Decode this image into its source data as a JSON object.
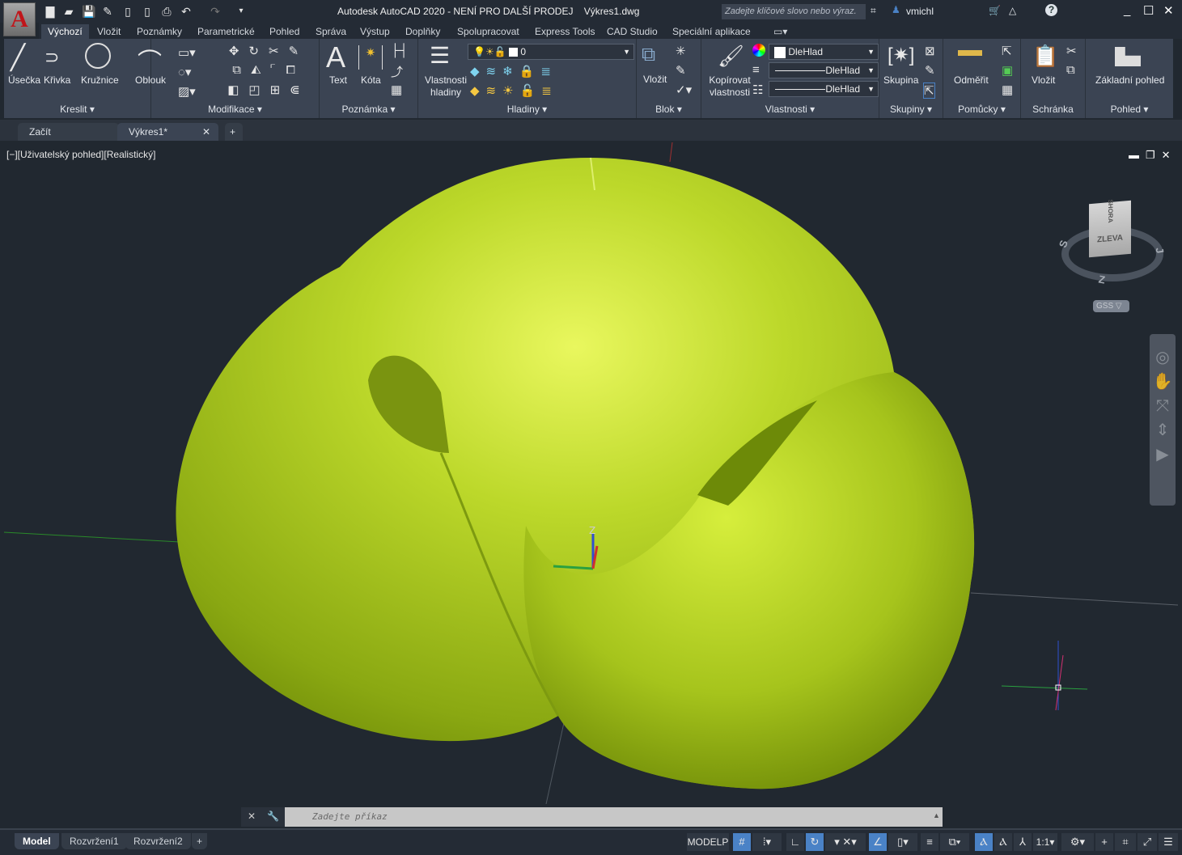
{
  "app": {
    "title": "Autodesk AutoCAD 2020 - NENÍ PRO DALŠÍ PRODEJ    Výkres1.dwg",
    "logo": "A",
    "search_placeholder": "Zadejte klíčové slovo nebo výraz.",
    "user": "vmichl"
  },
  "ribbon_tabs": [
    "Výchozí",
    "Vložit",
    "Poznámky",
    "Parametrické",
    "Pohled",
    "Správa",
    "Výstup",
    "Doplňky",
    "Spolupracovat",
    "Express Tools",
    "CAD Studio",
    "Speciální aplikace"
  ],
  "panels": {
    "kreslit": {
      "title": "Kreslit",
      "buttons": [
        "Úsečka",
        "Křivka",
        "Kružnice",
        "Oblouk"
      ]
    },
    "modifikace": {
      "title": "Modifikace"
    },
    "poznamka": {
      "title": "Poznámka",
      "buttons": [
        "Text",
        "Kóta"
      ]
    },
    "hladiny": {
      "title": "Hladiny",
      "button": "Vlastnosti hladiny",
      "layer": "0"
    },
    "blok": {
      "title": "Blok",
      "button": "Vložit"
    },
    "vlastnosti": {
      "title": "Vlastnosti",
      "button": "Kopírovat vlastnosti",
      "color": "DleHlad",
      "linetype": "DleHlad",
      "lineweight": "DleHlad"
    },
    "skupiny": {
      "title": "Skupiny",
      "button": "Skupina"
    },
    "pomucky": {
      "title": "Pomůcky",
      "button": "Odměřit"
    },
    "schranka": {
      "title": "Schránka",
      "button": "Vložit"
    },
    "pohled": {
      "title": "Pohled",
      "button": "Základní pohled"
    }
  },
  "doc_tabs": [
    "Začít",
    "Výkres1*"
  ],
  "viewport": {
    "label": "[−][Uživatelský pohled][Realistický]",
    "viewcube_face": "ZLEVA",
    "viewcube_top": "SHORA",
    "compass": [
      "S",
      "J",
      "Z"
    ],
    "ucs": "GSS",
    "ucs_axis": "Z"
  },
  "command": {
    "placeholder": "Zadejte příkaz"
  },
  "layout_tabs": [
    "Model",
    "Rozvržení1",
    "Rozvržení2"
  ],
  "status": {
    "mode": "MODELP",
    "scale": "1:1"
  },
  "colors": {
    "accent": "#4a82c6",
    "model": "#a8c818",
    "background": "#212830"
  }
}
